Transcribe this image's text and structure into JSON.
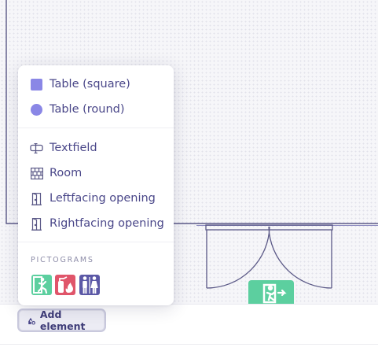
{
  "menu": {
    "items": [
      {
        "label": "Table (square)",
        "icon": "table-square-icon"
      },
      {
        "label": "Table (round)",
        "icon": "table-round-icon"
      },
      {
        "label": "Textfield",
        "icon": "textfield-icon"
      },
      {
        "label": "Room",
        "icon": "room-icon"
      },
      {
        "label": "Leftfacing opening",
        "icon": "door-left-icon"
      },
      {
        "label": "Rightfacing opening",
        "icon": "door-right-icon"
      }
    ],
    "section_title": "PICTOGRAMS",
    "pictograms": [
      {
        "name": "emergency-exit-pictogram",
        "color": "#5ccf9f"
      },
      {
        "name": "fire-extinguisher-pictogram",
        "color": "#e0556a"
      },
      {
        "name": "restroom-pictogram",
        "color": "#5b58a6"
      }
    ]
  },
  "toolbar": {
    "add_label": "Add element"
  },
  "colors": {
    "accent": "#8a87e6",
    "text": "#4a4789",
    "wall": "#5b5987",
    "exit_green": "#5ccf9f"
  }
}
